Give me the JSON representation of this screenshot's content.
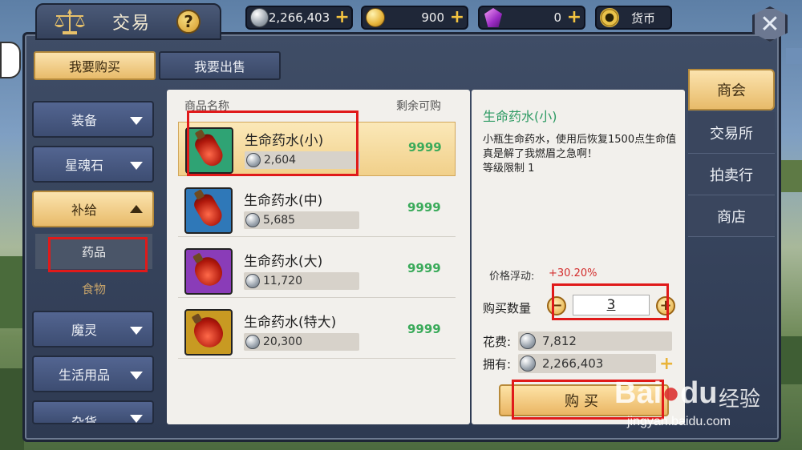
{
  "header": {
    "title": "交易",
    "help_label": "?",
    "close_label": "✕"
  },
  "currencies": [
    {
      "icon": "silver-coin-icon",
      "value": "2,266,403"
    },
    {
      "icon": "gold-coin-icon",
      "value": "900"
    },
    {
      "icon": "purple-gem-icon",
      "value": "0"
    },
    {
      "icon": "currency-ring-icon",
      "value": "货币"
    }
  ],
  "top_tabs": [
    {
      "label": "我要购买",
      "active": true
    },
    {
      "label": "我要出售",
      "active": false
    }
  ],
  "categories": [
    {
      "label": "装备",
      "expanded": false
    },
    {
      "label": "星魂石",
      "expanded": false
    },
    {
      "label": "补给",
      "expanded": true
    },
    {
      "label": "魔灵",
      "expanded": false
    },
    {
      "label": "生活用品",
      "expanded": false
    },
    {
      "label": "杂货",
      "expanded": false
    }
  ],
  "sub_categories": [
    {
      "label": "药品",
      "active": true
    },
    {
      "label": "食物",
      "active": false
    }
  ],
  "item_list": {
    "col_name": "商品名称",
    "col_remain": "剩余可购",
    "items": [
      {
        "name": "生命药水(小)",
        "price": "2,604",
        "remain": "9999",
        "selected": true,
        "frame_color": "#2fa374"
      },
      {
        "name": "生命药水(中)",
        "price": "5,685",
        "remain": "9999",
        "selected": false,
        "frame_color": "#2f78b8"
      },
      {
        "name": "生命药水(大)",
        "price": "11,720",
        "remain": "9999",
        "selected": false,
        "frame_color": "#8a3cb8"
      },
      {
        "name": "生命药水(特大)",
        "price": "20,300",
        "remain": "9999",
        "selected": false,
        "frame_color": "#c89a22"
      }
    ]
  },
  "detail": {
    "title": "生命药水(小)",
    "desc_1": "小瓶生命药水，使用后恢复1500点生命值",
    "desc_2": "真是解了我燃眉之急啊！",
    "desc_3": "等级限制 1",
    "price_float_label": "价格浮动:",
    "price_float_value": "+30.20%",
    "qty_label": "购买数量",
    "qty_value": "3",
    "minus_label": "−",
    "plus_label": "+",
    "cost_label": "花费:",
    "cost_value": "7,812",
    "owned_label": "拥有:",
    "owned_value": "2,266,403",
    "buy_label": "购买"
  },
  "side_tabs": [
    {
      "label": "商会",
      "active": true
    },
    {
      "label": "交易所",
      "active": false
    },
    {
      "label": "拍卖行",
      "active": false
    },
    {
      "label": "商店",
      "active": false
    }
  ],
  "watermark": {
    "logo": "Bai",
    "logo_tail": "du",
    "cn": "经验",
    "url": "jingyan.baidu.com"
  },
  "colors": {
    "accent_gold": "#e8bb6a",
    "remain_green": "#3aaa5a",
    "title_green": "#2d9a63",
    "float_red": "#d32c2c",
    "highlight_red": "#e01a1a"
  }
}
